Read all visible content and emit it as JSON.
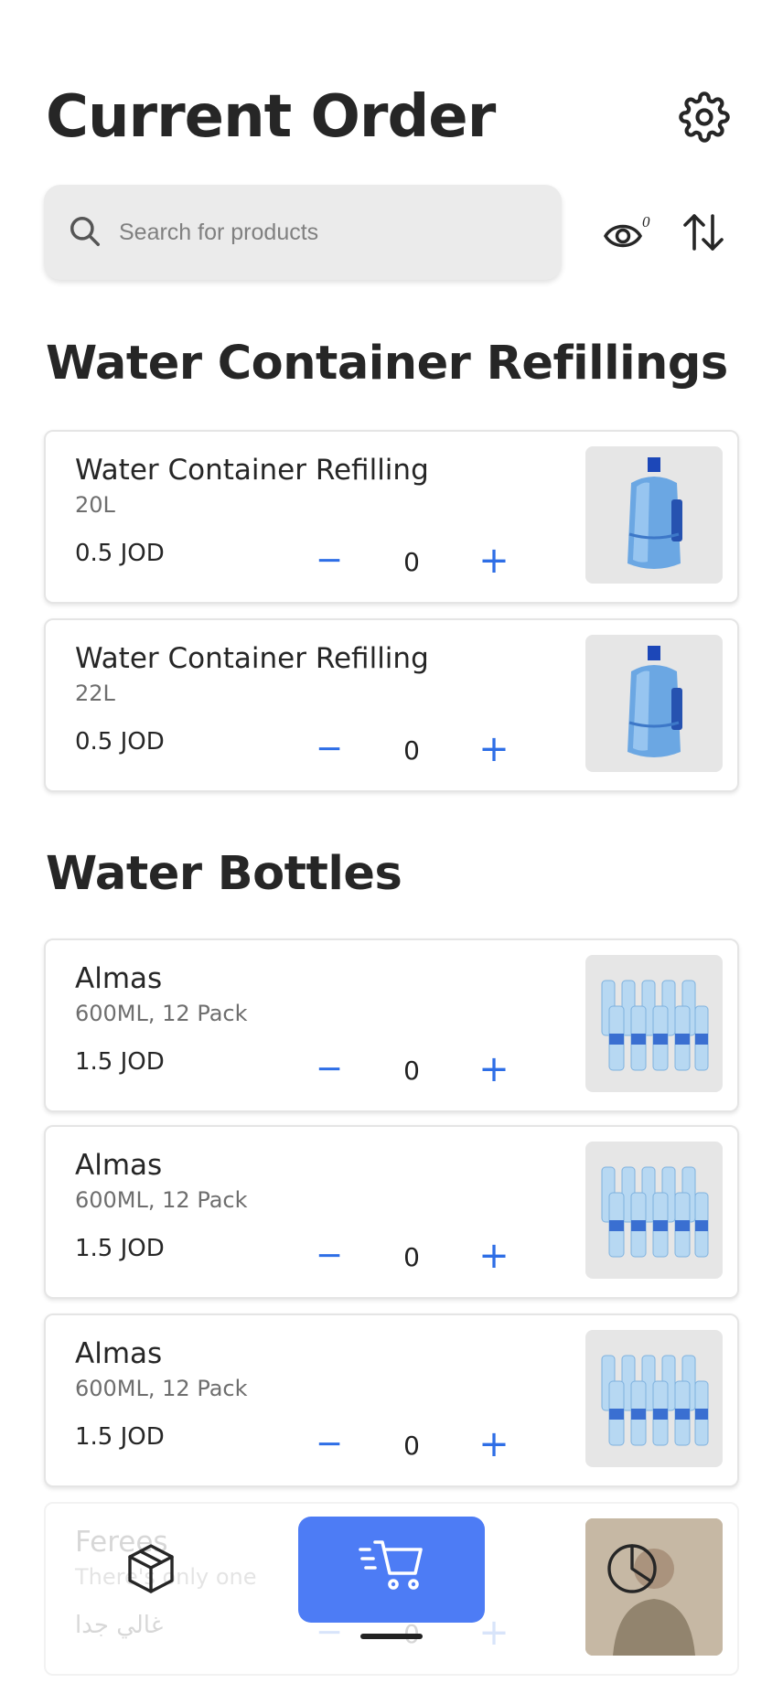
{
  "header": {
    "title": "Current Order",
    "settings_icon": "gear-icon"
  },
  "search": {
    "placeholder": "Search for products",
    "value": "",
    "visibility_count": "0"
  },
  "sections": [
    {
      "title": "Water Container Refillings",
      "items": [
        {
          "name": "Water Container Refilling",
          "sub": "20L",
          "price": "0.5 JOD",
          "qty": "0",
          "image": "water-jug"
        },
        {
          "name": "Water Container Refilling",
          "sub": "22L",
          "price": "0.5 JOD",
          "qty": "0",
          "image": "water-jug"
        }
      ]
    },
    {
      "title": "Water Bottles",
      "items": [
        {
          "name": "Almas",
          "sub": "600ML, 12 Pack",
          "price": "1.5 JOD",
          "qty": "0",
          "image": "bottle-pack"
        },
        {
          "name": "Almas",
          "sub": "600ML, 12 Pack",
          "price": "1.5 JOD",
          "qty": "0",
          "image": "bottle-pack"
        },
        {
          "name": "Almas",
          "sub": "600ML, 12 Pack",
          "price": "1.5 JOD",
          "qty": "0",
          "image": "bottle-pack"
        },
        {
          "name": "Ferees",
          "sub": "There's only one",
          "price": "غالي جدا",
          "qty": "0",
          "image": "person-photo"
        }
      ]
    }
  ],
  "qty_controls": {
    "minus": "−",
    "plus": "+"
  },
  "nav": {
    "items": [
      "box-icon",
      "cart-icon",
      "pie-chart-icon"
    ],
    "active": "cart-icon"
  },
  "colors": {
    "accent": "#4d7cf5",
    "stepper": "#2e6ee6",
    "search_bg": "#ebebeb",
    "thumb_bg": "#e6e6e6"
  }
}
